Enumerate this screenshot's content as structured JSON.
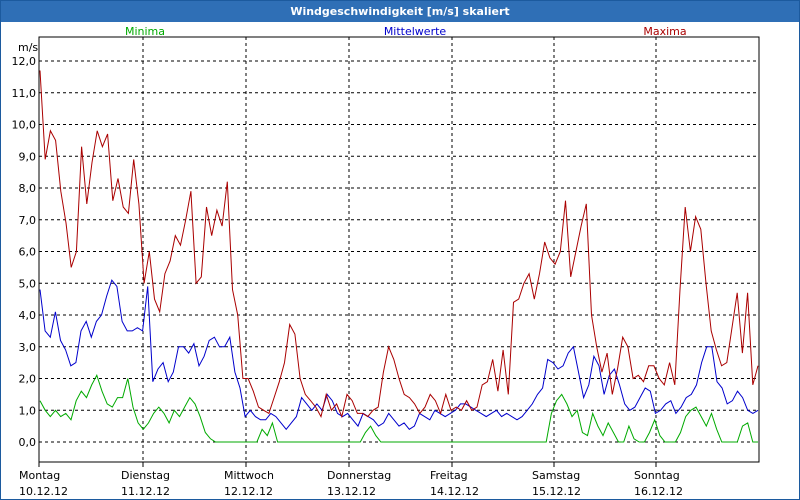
{
  "window": {
    "title": "Windgeschwindigkeit [m/s] skaliert"
  },
  "chart_data": {
    "type": "line",
    "title": "Windgeschwindigkeit [m/s] skaliert",
    "ylabel": "m/s",
    "ylim": [
      0,
      12
    ],
    "y_ticks": [
      "0,0",
      "1,0",
      "2,0",
      "3,0",
      "4,0",
      "5,0",
      "6,0",
      "7,0",
      "8,0",
      "9,0",
      "10,0",
      "11,0",
      "12,0"
    ],
    "x_days": [
      {
        "day": "Montag",
        "date": "10.12.12"
      },
      {
        "day": "Dienstag",
        "date": "11.12.12"
      },
      {
        "day": "Mittwoch",
        "date": "12.12.12"
      },
      {
        "day": "Donnerstag",
        "date": "13.12.12"
      },
      {
        "day": "Freitag",
        "date": "14.12.12"
      },
      {
        "day": "Samstag",
        "date": "15.12.12"
      },
      {
        "day": "Sonntag",
        "date": "16.12.12"
      }
    ],
    "grid": true,
    "series": [
      {
        "name": "Minima",
        "color": "#00aa00",
        "values": [
          1.3,
          1.0,
          0.8,
          1.0,
          0.8,
          0.9,
          0.7,
          1.3,
          1.6,
          1.4,
          1.8,
          2.1,
          1.6,
          1.2,
          1.1,
          1.4,
          1.4,
          2.0,
          1.1,
          0.6,
          0.4,
          0.6,
          0.9,
          1.1,
          0.9,
          0.6,
          1.0,
          0.8,
          1.1,
          1.4,
          1.2,
          0.8,
          0.3,
          0.1,
          0.0,
          0.0,
          0.0,
          0.0,
          0.0,
          0.0,
          0.0,
          0.0,
          0.0,
          0.4,
          0.2,
          0.6,
          0.0,
          0.0,
          0.0,
          0.0,
          0.0,
          0.0,
          0.0,
          0.0,
          0.0,
          0.0,
          0.0,
          0.0,
          0.0,
          0.0,
          0.0,
          0.0,
          0.0,
          0.3,
          0.5,
          0.2,
          0.0,
          0.0,
          0.0,
          0.0,
          0.0,
          0.0,
          0.0,
          0.0,
          0.0,
          0.0,
          0.0,
          0.0,
          0.0,
          0.0,
          0.0,
          0.0,
          0.0,
          0.0,
          0.0,
          0.0,
          0.0,
          0.0,
          0.0,
          0.0,
          0.0,
          0.0,
          0.0,
          0.0,
          0.0,
          0.0,
          0.0,
          0.0,
          0.0,
          0.9,
          1.3,
          1.5,
          1.2,
          0.8,
          1.0,
          0.3,
          0.2,
          0.9,
          0.5,
          0.2,
          0.6,
          0.3,
          0.0,
          0.0,
          0.5,
          0.1,
          0.0,
          0.0,
          0.3,
          0.7,
          0.2,
          0.0,
          0.0,
          0.0,
          0.3,
          0.8,
          1.0,
          1.1,
          0.8,
          0.5,
          0.9,
          0.4,
          0.0,
          0.0,
          0.0,
          0.0,
          0.5,
          0.6,
          0.0,
          0.0
        ]
      },
      {
        "name": "Mittelwerte",
        "color": "#0000cc",
        "values": [
          4.8,
          3.5,
          3.3,
          4.1,
          3.2,
          2.9,
          2.4,
          2.5,
          3.5,
          3.8,
          3.3,
          3.8,
          4.0,
          4.6,
          5.1,
          4.9,
          3.8,
          3.5,
          3.5,
          3.6,
          3.5,
          4.9,
          1.9,
          2.3,
          2.5,
          1.9,
          2.2,
          3.0,
          3.0,
          2.8,
          3.1,
          2.4,
          2.7,
          3.2,
          3.3,
          3.0,
          3.0,
          3.3,
          2.2,
          1.7,
          0.8,
          1.0,
          0.8,
          0.7,
          0.7,
          0.9,
          0.8,
          0.6,
          0.4,
          0.6,
          0.8,
          1.4,
          1.2,
          1.0,
          1.2,
          1.0,
          1.5,
          1.3,
          0.9,
          0.8,
          0.9,
          0.7,
          0.5,
          0.9,
          0.8,
          0.7,
          0.5,
          0.6,
          0.9,
          0.7,
          0.5,
          0.6,
          0.4,
          0.5,
          0.9,
          0.8,
          0.7,
          1.0,
          0.9,
          0.8,
          0.9,
          1.0,
          1.2,
          1.2,
          1.1,
          1.0,
          0.9,
          0.8,
          0.9,
          1.0,
          0.8,
          0.9,
          0.8,
          0.7,
          0.8,
          1.0,
          1.2,
          1.5,
          1.7,
          2.6,
          2.5,
          2.3,
          2.4,
          2.8,
          3.0,
          2.2,
          1.4,
          1.8,
          2.7,
          2.4,
          1.5,
          2.1,
          2.3,
          1.8,
          1.2,
          1.0,
          1.1,
          1.4,
          1.7,
          1.6,
          0.9,
          1.0,
          1.2,
          1.3,
          0.9,
          1.1,
          1.4,
          1.5,
          1.8,
          2.5,
          3.0,
          3.0,
          1.9,
          1.7,
          1.2,
          1.3,
          1.6,
          1.4,
          1.0,
          0.9,
          1.0
        ]
      },
      {
        "name": "Maxima",
        "color": "#aa0000",
        "values": [
          11.7,
          8.9,
          9.8,
          9.5,
          7.9,
          6.9,
          5.5,
          6.0,
          9.3,
          7.5,
          8.8,
          9.8,
          9.3,
          9.7,
          7.6,
          8.3,
          7.4,
          7.2,
          8.9,
          7.5,
          5.0,
          6.0,
          4.5,
          4.1,
          5.3,
          5.7,
          6.5,
          6.2,
          7.0,
          7.9,
          5.0,
          5.2,
          7.4,
          6.5,
          7.3,
          6.8,
          8.2,
          4.8,
          4.0,
          2.0,
          2.0,
          1.6,
          1.1,
          1.0,
          0.9,
          1.4,
          1.9,
          2.5,
          3.7,
          3.4,
          2.0,
          1.5,
          1.3,
          1.1,
          0.8,
          1.5,
          1.0,
          1.2,
          0.8,
          1.5,
          1.3,
          0.9,
          0.9,
          0.8,
          1.0,
          1.1,
          2.2,
          3.0,
          2.6,
          2.0,
          1.5,
          1.4,
          1.2,
          0.9,
          1.1,
          1.5,
          1.3,
          0.9,
          1.5,
          1.0,
          1.1,
          1.0,
          1.3,
          1.0,
          1.1,
          1.8,
          1.9,
          2.6,
          1.6,
          2.9,
          1.5,
          4.4,
          4.5,
          5.0,
          5.3,
          4.5,
          5.3,
          6.3,
          5.8,
          5.6,
          6.0,
          7.6,
          5.2,
          6.0,
          6.8,
          7.5,
          4.0,
          3.0,
          2.2,
          2.8,
          1.5,
          2.3,
          3.3,
          3.0,
          2.0,
          2.1,
          1.9,
          2.4,
          2.4,
          2.0,
          1.8,
          2.5,
          1.8,
          4.8,
          7.4,
          6.0,
          7.1,
          6.7,
          5.0,
          3.5,
          2.9,
          2.4,
          2.5,
          3.6,
          4.7,
          2.8,
          4.7,
          1.8,
          2.4
        ]
      }
    ]
  }
}
